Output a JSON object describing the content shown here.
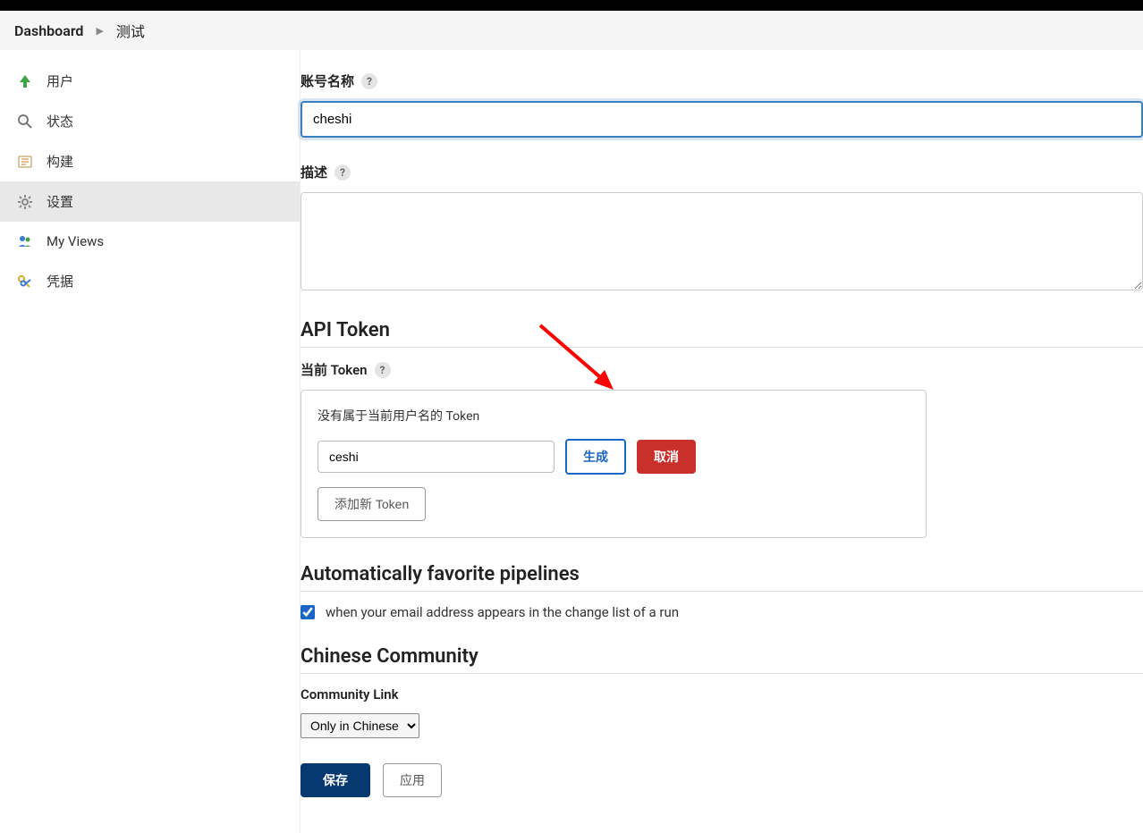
{
  "breadcrumb": {
    "dashboard_label": "Dashboard",
    "page_label": "测试"
  },
  "sidebar": {
    "items": [
      {
        "label": "用户"
      },
      {
        "label": "状态"
      },
      {
        "label": "构建"
      },
      {
        "label": "设置"
      },
      {
        "label": "My Views"
      },
      {
        "label": "凭据"
      }
    ]
  },
  "form": {
    "account_name": {
      "label": "账号名称",
      "value": "cheshi"
    },
    "description": {
      "label": "描述",
      "value": ""
    }
  },
  "api_token": {
    "heading": "API Token",
    "current_label": "当前 Token",
    "empty_text": "没有属于当前用户名的 Token",
    "name_value": "ceshi",
    "generate_button": "生成",
    "cancel_button": "取消",
    "add_button": "添加新 Token"
  },
  "auto_favorite": {
    "heading": "Automatically favorite pipelines",
    "checkbox_label": "when your email address appears in the change list of a run"
  },
  "community": {
    "heading": "Chinese Community",
    "link_label": "Community Link",
    "selected": "Only in Chinese"
  },
  "footer": {
    "save_button": "保存",
    "apply_button": "应用"
  }
}
